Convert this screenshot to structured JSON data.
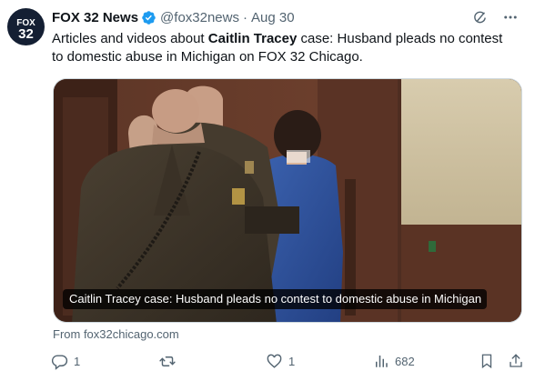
{
  "author": {
    "name": "FOX 32 News",
    "handle": "@fox32news",
    "separator": "·",
    "time": "Aug 30",
    "verified": true,
    "avatar_text_top": "FOX",
    "avatar_text_bottom": "32"
  },
  "post": {
    "text_before": "Articles and videos about ",
    "text_bold": "Caitlin Tracey",
    "text_after": " case: Husband pleads no contest to domestic abuse in Michigan on FOX 32 Chicago."
  },
  "card": {
    "caption": "Caitlin Tracey case: Husband pleads no contest to domestic abuse in Michigan",
    "source": "From fox32chicago.com"
  },
  "actions": {
    "replies": "1",
    "reposts": "",
    "likes": "1",
    "views": "682"
  },
  "icons": {
    "verified": "verified-badge-icon",
    "grok": "grok-icon",
    "more": "more-icon",
    "reply": "reply-icon",
    "repost": "repost-icon",
    "like": "heart-icon",
    "views": "views-icon",
    "bookmark": "bookmark-icon",
    "share": "share-icon"
  },
  "colors": {
    "text": "#0f1419",
    "secondary": "#536471",
    "verified": "#1d9bf0",
    "avatar_bg": "#141f33"
  }
}
